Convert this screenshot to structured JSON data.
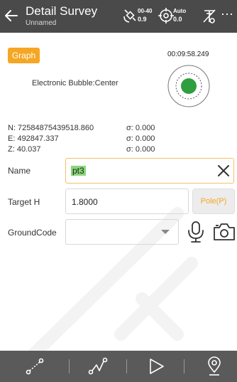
{
  "header": {
    "title": "Detail Survey",
    "subtitle": "Unnamed",
    "satellite": {
      "icon": "satellite-icon",
      "value1": "00-40",
      "value2": "0.9"
    },
    "position": {
      "icon": "gps-target-icon",
      "value1": "Auto",
      "value2": "0.0"
    },
    "antenna_icon": "antenna-off-icon",
    "more": "⋯"
  },
  "graph": {
    "button_label": "Graph",
    "timer": "00:09:58.249",
    "bubble_label": "Electronic Bubble:Center"
  },
  "coords": {
    "n": "N: 72584875439518.860",
    "e": "E: 492847.337",
    "z": "Z: 40.037",
    "sigma_n": "σ: 0.000",
    "sigma_e": "σ: 0.000",
    "sigma_z": "σ: 0.000"
  },
  "form": {
    "name_label": "Name",
    "name_value": "pt3",
    "target_h_label": "Target H",
    "target_h_value": "1.8000",
    "pole_button": "Pole(P)",
    "ground_code_label": "GroundCode",
    "ground_code_value": ""
  },
  "bottom_bar": [
    "line-segment-icon",
    "polyline-icon",
    "play-icon",
    "location-pin-icon"
  ],
  "colors": {
    "accent": "#f5a623",
    "header": "#4a4a4a",
    "bottom": "#5a5a5a",
    "bubble": "#2e9e3e",
    "highlight": "#8bd67a"
  }
}
